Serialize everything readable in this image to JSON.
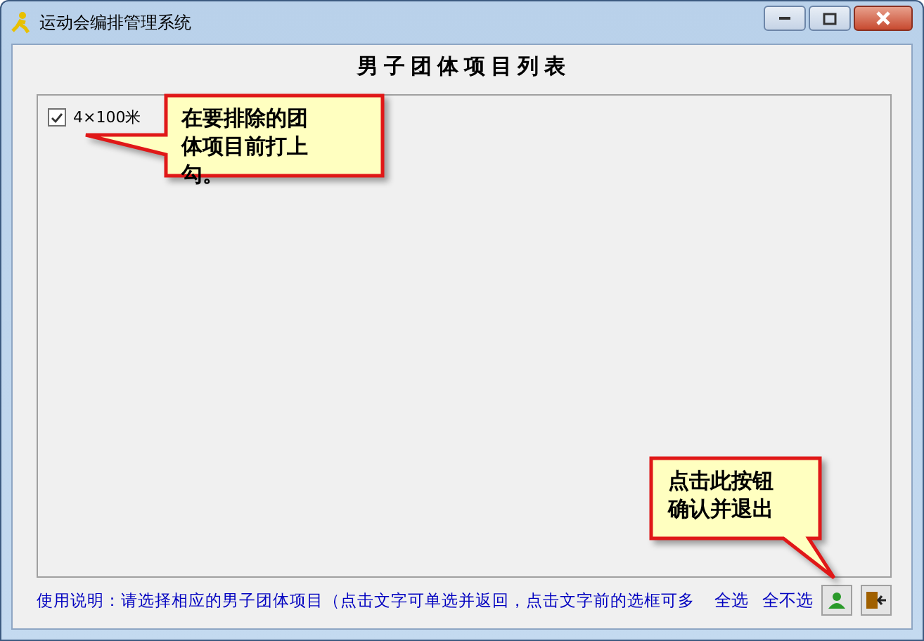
{
  "window": {
    "title": "运动会编排管理系统"
  },
  "heading": "男子团体项目列表",
  "items": [
    {
      "label": "4×100米",
      "checked": true
    }
  ],
  "instructions": "使用说明：请选择相应的男子团体项目（点击文字可单选并返回，点击文字前的选框可多",
  "links": [
    "全选",
    "全不选"
  ],
  "callouts": [
    {
      "text": "在要排除的团体项目前打上勾。"
    },
    {
      "text": "点击此按钮确认并退出"
    }
  ]
}
